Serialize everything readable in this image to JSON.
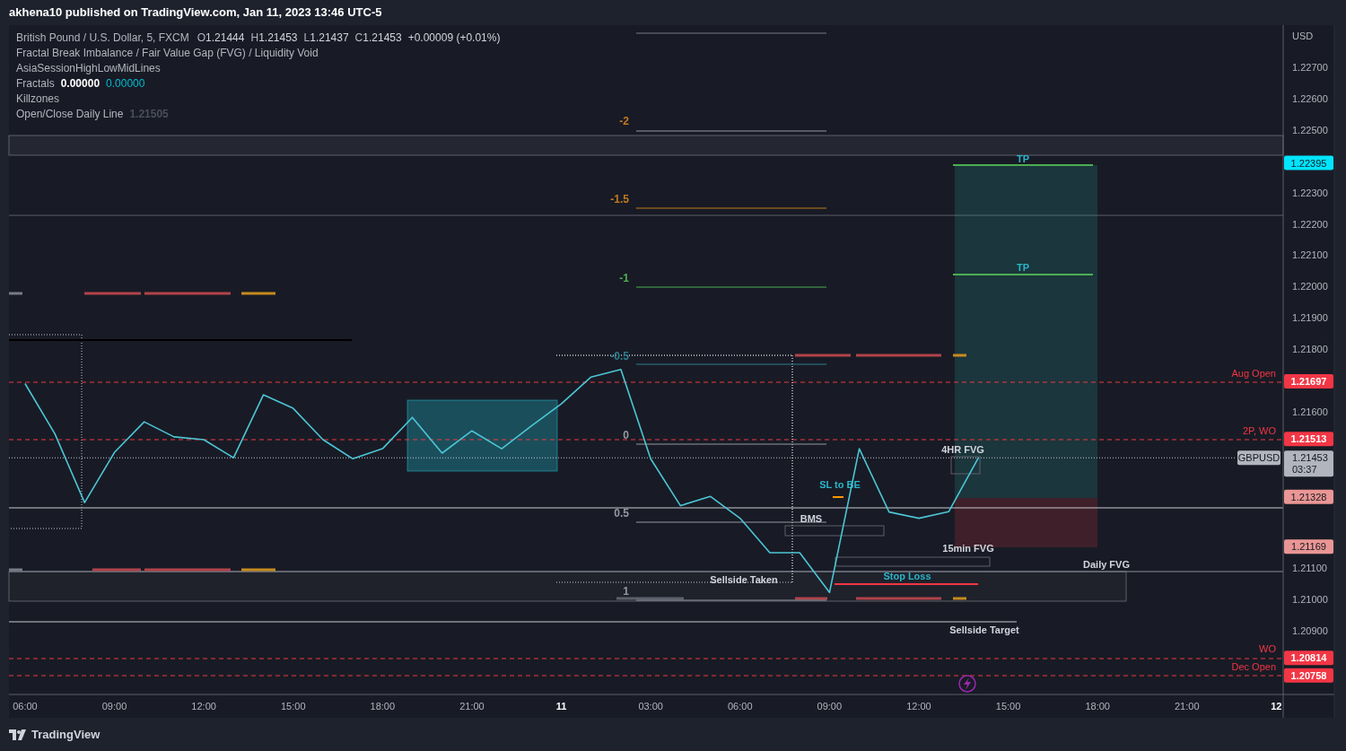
{
  "caption": "akhena10 published on TradingView.com, Jan 11, 2023 13:46 UTC-5",
  "legend": {
    "symbol": {
      "title": "British Pound / U.S. Dollar, 5, FXCM",
      "ohlc": [
        {
          "label": "O",
          "value": "1.21444"
        },
        {
          "label": "H",
          "value": "1.21453"
        },
        {
          "label": "L",
          "value": "1.21437"
        },
        {
          "label": "C",
          "value": "1.21453"
        }
      ],
      "change": "+0.00009 (+0.01%)"
    },
    "indicators": [
      {
        "name": "Fractal Break Imbalance / Fair Value Gap (FVG) / Liquidity Void"
      },
      {
        "name": "AsiaSessionHighLowMidLines"
      },
      {
        "name": "Fractals",
        "values": [
          {
            "text": "0.00000",
            "color": "#ffffff"
          },
          {
            "text": "0.00000",
            "color": "#00bcd4"
          }
        ]
      },
      {
        "name": "Killzones"
      },
      {
        "name": "Open/Close Daily Line",
        "values": [
          {
            "text": "1.21505",
            "color": "#4a4e59"
          }
        ]
      }
    ]
  },
  "chart_data": {
    "type": "line",
    "ylabel": "USD",
    "categories": [
      "06:00",
      null,
      null,
      "09:00",
      null,
      null,
      "12:00",
      null,
      null,
      "15:00",
      null,
      null,
      "18:00",
      null,
      null,
      "21:00",
      null,
      null,
      "11",
      null,
      null,
      "03:00",
      null,
      null,
      "06:00",
      null,
      null,
      "09:00",
      null,
      null,
      "12:00",
      null,
      null,
      "15:00",
      null,
      null,
      "18:00",
      null,
      null,
      "21:00",
      null,
      null,
      "12"
    ],
    "series": [
      {
        "color": "#4dc6d6",
        "values": [
          1.2169,
          1.2153,
          1.2131,
          1.2147,
          1.21568,
          1.2152,
          1.21511,
          1.21453,
          1.21654,
          1.21611,
          1.21511,
          1.2145,
          1.21482,
          1.21582,
          1.21468,
          1.21539,
          1.21482,
          1.21555,
          1.21625,
          1.21711,
          1.21735,
          1.2145,
          1.213,
          1.2133,
          1.2126,
          1.2115,
          1.2115,
          1.21023,
          1.21482,
          1.2128,
          1.2126,
          1.21281,
          1.21453,
          null,
          null,
          null,
          null,
          null,
          null,
          null,
          null,
          null,
          null
        ]
      }
    ],
    "ylim": [
      1.207,
      1.22835
    ],
    "yticks": [
      {
        "value": 1.227,
        "label": "1.22700"
      },
      {
        "value": 1.226,
        "label": "1.22600"
      },
      {
        "value": 1.225,
        "label": "1.22500"
      },
      {
        "value": 1.223,
        "label": "1.22300"
      },
      {
        "value": 1.222,
        "label": "1.22200"
      },
      {
        "value": 1.221,
        "label": "1.22100"
      },
      {
        "value": 1.22,
        "label": "1.22000"
      },
      {
        "value": 1.219,
        "label": "1.21900"
      },
      {
        "value": 1.218,
        "label": "1.21800"
      },
      {
        "value": 1.216,
        "label": "1.21600"
      },
      {
        "value": 1.211,
        "label": "1.21100"
      },
      {
        "value": 1.21,
        "label": "1.21000"
      },
      {
        "value": 1.209,
        "label": "1.20900"
      }
    ]
  },
  "chart_labels": [
    {
      "text": "-2",
      "kind": "fib",
      "color": "#c47a1d"
    },
    {
      "text": "-1.5",
      "kind": "fib",
      "color": "#c47a1d"
    },
    {
      "text": "-1",
      "kind": "fib",
      "color": "#4caf50"
    },
    {
      "text": "-0.5",
      "kind": "fib",
      "color": "#2c7f8f"
    },
    {
      "text": "0",
      "kind": "fib",
      "color": "#9598a1"
    },
    {
      "text": "0.5",
      "kind": "fib",
      "color": "#9598a1"
    },
    {
      "text": "1",
      "kind": "fib",
      "color": "#9598a1"
    },
    {
      "text": "TP",
      "kind": "tag",
      "color": "#2ab5c9"
    },
    {
      "text": "TP",
      "kind": "tag",
      "color": "#2ab5c9"
    },
    {
      "text": "Aug Open",
      "kind": "level",
      "color": "#f23645"
    },
    {
      "text": "2P, WO",
      "kind": "level",
      "color": "#f23645"
    },
    {
      "text": "4HR FVG",
      "kind": "tag",
      "color": "#d1d4dc"
    },
    {
      "text": "SL to BE",
      "kind": "tag",
      "color": "#2ab5c9"
    },
    {
      "text": "BMS",
      "kind": "tag",
      "color": "#d1d4dc"
    },
    {
      "text": "15min FVG",
      "kind": "tag",
      "color": "#d1d4dc"
    },
    {
      "text": "Daily FVG",
      "kind": "tag",
      "color": "#d1d4dc"
    },
    {
      "text": "Stop Loss",
      "kind": "tag",
      "color": "#2ab5c9"
    },
    {
      "text": "Sellside Taken",
      "kind": "tag",
      "color": "#d1d4dc"
    },
    {
      "text": "Sellside Target",
      "kind": "tag",
      "color": "#d1d4dc"
    },
    {
      "text": "WO",
      "kind": "level",
      "color": "#f23645"
    },
    {
      "text": "Dec Open",
      "kind": "level",
      "color": "#f23645"
    }
  ],
  "price_badges": [
    {
      "label": "1.22395",
      "kind": "light",
      "color": "#00e5ff"
    },
    {
      "label": "1.21697",
      "kind": "solid",
      "color": "#f23645"
    },
    {
      "label": "1.21513",
      "kind": "solid",
      "color": "#f23645"
    },
    {
      "label": "1.21328",
      "kind": "light",
      "color": "#e99694"
    },
    {
      "label": "1.21169",
      "kind": "light",
      "color": "#e99694"
    },
    {
      "label": "1.20814",
      "kind": "solid",
      "color": "#f23645"
    },
    {
      "label": "1.20758",
      "kind": "solid",
      "color": "#f23645"
    }
  ],
  "last_price": {
    "symbol": "GBPUSD",
    "price": "1.21453",
    "countdown": "03:37"
  },
  "footer": {
    "brand": "TradingView"
  }
}
